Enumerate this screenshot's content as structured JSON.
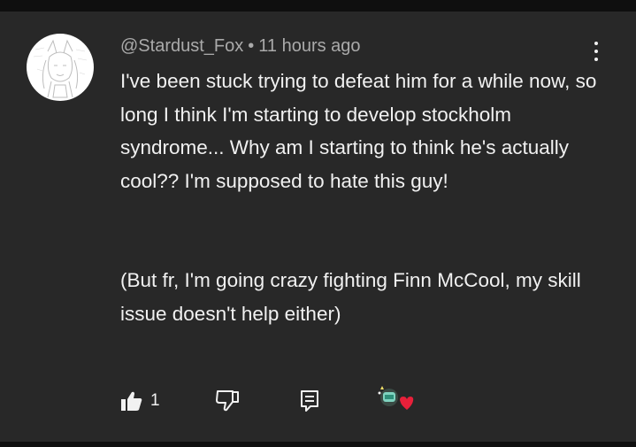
{
  "comment": {
    "author": "@Stardust_Fox",
    "separator": "•",
    "timestamp": "11 hours ago",
    "paragraphs": [
      "I've been stuck trying to defeat him for a while now, so long I think I'm starting to develop stockholm syndrome... Why am I starting to think he's actually cool?? I'm supposed to hate this guy!",
      "(But fr, I'm going crazy fighting Finn McCool, my skill issue doesn't help either)"
    ],
    "like_count": "1"
  },
  "icons": {
    "more": "more-vert-icon",
    "like": "thumbs-up-icon",
    "dislike": "thumbs-down-icon",
    "reply": "reply-icon",
    "creator_heart": "creator-heart-icon"
  },
  "colors": {
    "background": "#282828",
    "frame": "#0f0f0f",
    "text_primary": "#f1f1f1",
    "text_secondary": "#aaaaaa",
    "heart": "#e8203a"
  }
}
